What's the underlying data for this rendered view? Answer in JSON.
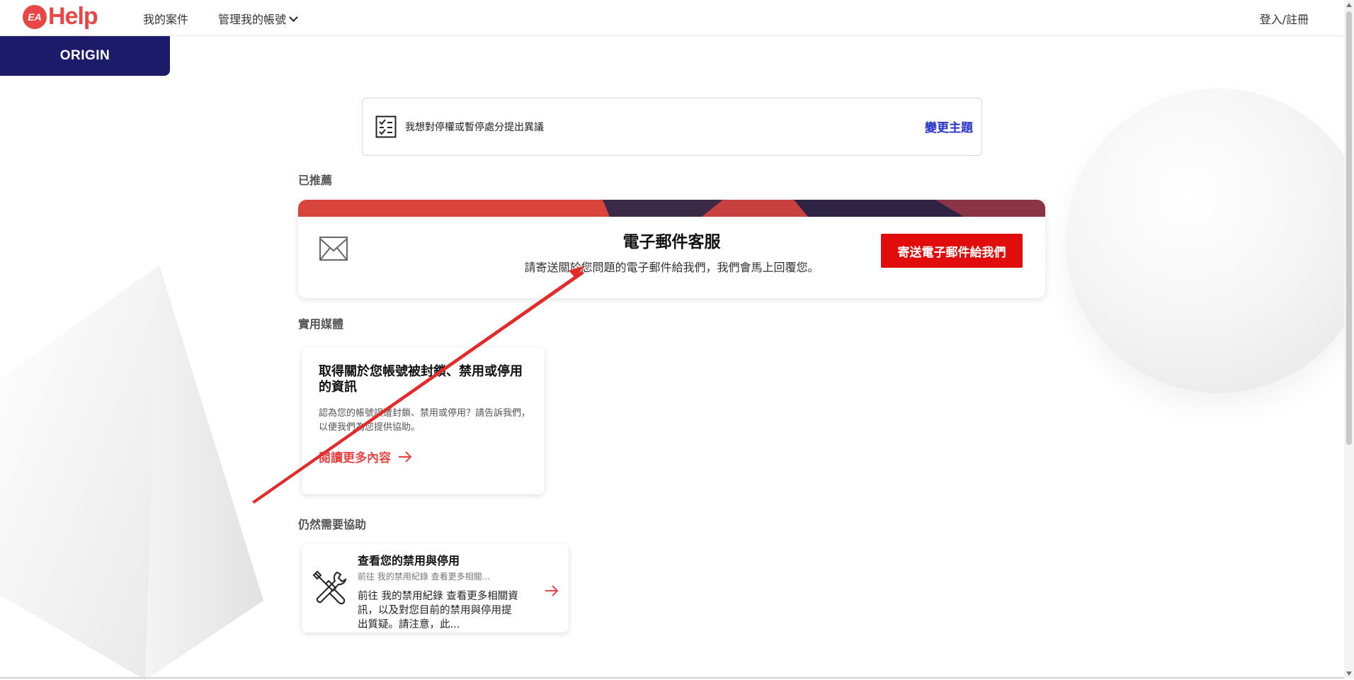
{
  "header": {
    "logo_badge": "EA",
    "logo_word": "Help",
    "nav_cases": "我的案件",
    "nav_account": "管理我的帳號",
    "nav_login": "登入/註冊"
  },
  "origin_tab": "ORIGIN",
  "topic": {
    "text": "我想對停權或暫停處分提出異議",
    "change_label": "變更主題"
  },
  "sections": {
    "recommended": "已推薦",
    "media": "實用媒體",
    "still_help": "仍然需要協助"
  },
  "email_card": {
    "title": "電子郵件客服",
    "description": "請寄送關於您問題的電子郵件給我們，我們會馬上回覆您。",
    "button": "寄送電子郵件給我們"
  },
  "article_card": {
    "title": "取得關於您帳號被封鎖、禁用或停用的資訊",
    "description": "認為您的帳號誤遭封鎖、禁用或停用？請告訴我們，以便我們為您提供協助。",
    "link": "閱讀更多內容"
  },
  "help_card": {
    "title": "查看您的禁用與停用",
    "subtitle": "前往 我的禁用紀錄 查看更多相關...",
    "body": "前往 我的禁用紀錄 查看更多相關資訊，以及對您目前的禁用與停用提出質疑。請注意，此..."
  },
  "colors": {
    "brand_red": "#e84545",
    "button_red": "#e10c0c",
    "origin_navy": "#1c1b6a",
    "link_blue": "#2a36c8"
  },
  "icons": [
    "checklist-icon",
    "mail-icon",
    "arrow-right-icon",
    "tools-icon",
    "chevron-down-icon"
  ]
}
